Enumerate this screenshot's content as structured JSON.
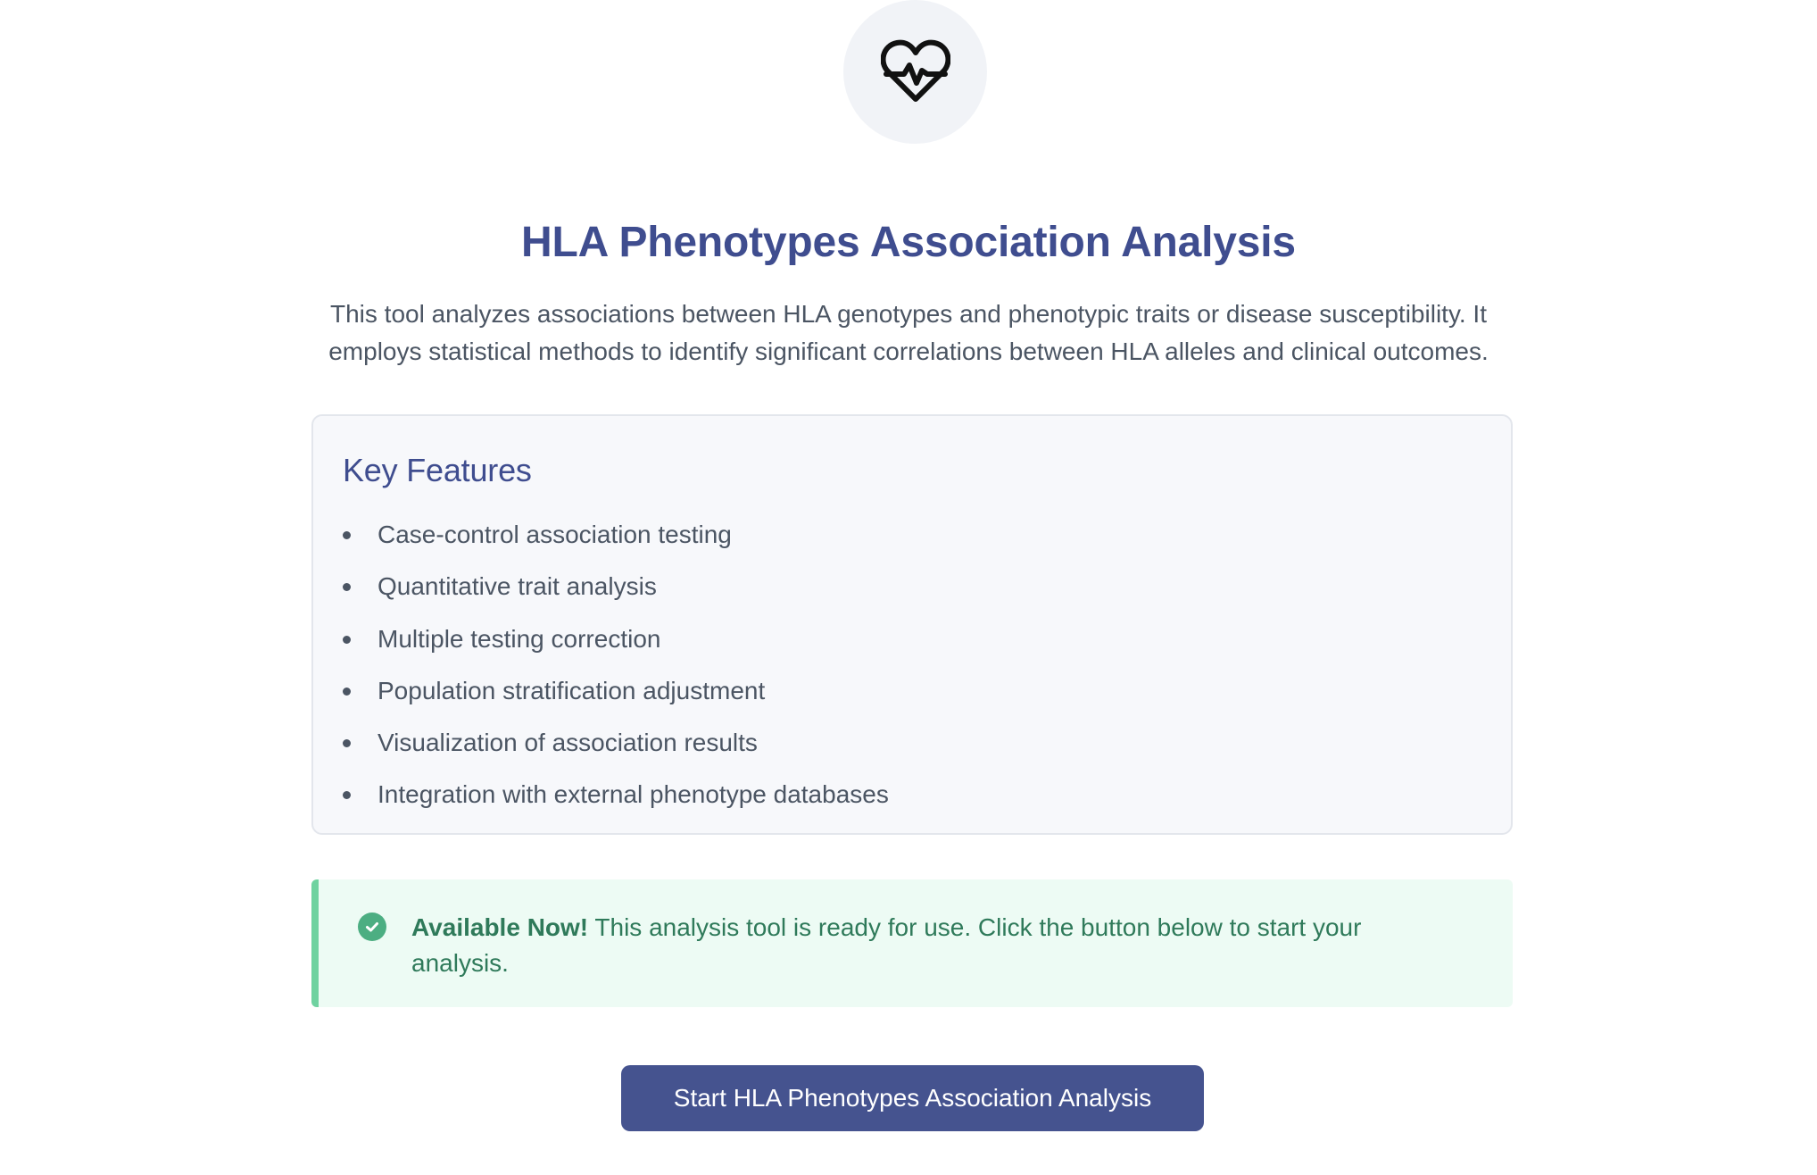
{
  "header": {
    "icon": "heart-pulse-icon",
    "title": "HLA Phenotypes Association Analysis",
    "description": "This tool analyzes associations between HLA genotypes and phenotypic traits or disease susceptibility. It employs statistical methods to identify significant correlations between HLA alleles and clinical outcomes."
  },
  "features": {
    "title": "Key Features",
    "items": [
      "Case-control association testing",
      "Quantitative trait analysis",
      "Multiple testing correction",
      "Population stratification adjustment",
      "Visualization of association results",
      "Integration with external phenotype databases"
    ]
  },
  "alert": {
    "icon": "check-circle-icon",
    "strong": "Available Now!",
    "text": " This analysis tool is ready for use. Click the button below to start your analysis."
  },
  "actions": {
    "start_label": "Start HLA Phenotypes Association Analysis"
  },
  "colors": {
    "brand": "#3f4d8f",
    "button": "#45538f",
    "success": "#4cae82",
    "success_bg": "#edfbf4",
    "success_border": "#6fd2a0"
  }
}
